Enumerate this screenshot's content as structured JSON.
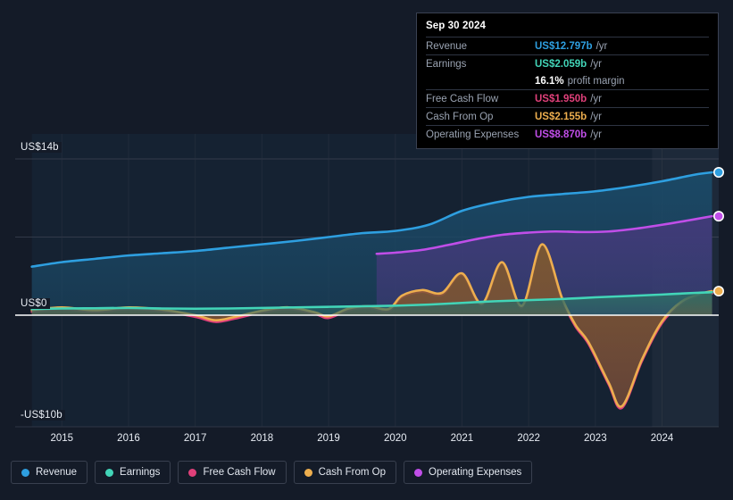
{
  "chart_data": {
    "type": "area",
    "title": "",
    "xlabel": "",
    "ylabel": "",
    "ylim": [
      -10,
      14
    ],
    "xlim": [
      2014.3,
      2024.85
    ],
    "grid": true,
    "legend_position": "bottom-left",
    "y_ticks": [
      {
        "value": 14,
        "label": "US$14b"
      },
      {
        "value": 0,
        "label": "US$0"
      },
      {
        "value": -10,
        "label": "-US$10b"
      }
    ],
    "x_ticks": [
      "2015",
      "2016",
      "2017",
      "2018",
      "2019",
      "2020",
      "2021",
      "2022",
      "2023",
      "2024"
    ],
    "x_tick_values": [
      2015,
      2016,
      2017,
      2018,
      2019,
      2020,
      2021,
      2022,
      2023,
      2024
    ],
    "series": [
      {
        "name": "Revenue",
        "color": "#2e9fe0",
        "fill": "#1b4a68",
        "x": [
          2014.55,
          2015.0,
          2015.5,
          2016.0,
          2016.5,
          2017.0,
          2017.5,
          2018.0,
          2018.5,
          2019.0,
          2019.5,
          2020.0,
          2020.5,
          2021.0,
          2021.5,
          2022.0,
          2022.5,
          2023.0,
          2023.5,
          2024.0,
          2024.5,
          2024.75
        ],
        "values": [
          4.35,
          4.75,
          5.05,
          5.35,
          5.55,
          5.75,
          6.05,
          6.35,
          6.65,
          7.0,
          7.35,
          7.55,
          8.1,
          9.35,
          10.1,
          10.6,
          10.85,
          11.1,
          11.5,
          12.0,
          12.6,
          12.797
        ]
      },
      {
        "name": "Earnings",
        "color": "#42d5b8",
        "fill": "#2e6b66",
        "x": [
          2014.55,
          2015.0,
          2015.5,
          2016.0,
          2016.5,
          2017.0,
          2017.5,
          2018.0,
          2018.5,
          2019.0,
          2019.5,
          2020.0,
          2020.5,
          2021.0,
          2021.5,
          2022.0,
          2022.5,
          2023.0,
          2023.5,
          2024.0,
          2024.5,
          2024.75
        ],
        "values": [
          0.55,
          0.6,
          0.62,
          0.65,
          0.6,
          0.58,
          0.6,
          0.65,
          0.7,
          0.75,
          0.8,
          0.85,
          0.95,
          1.1,
          1.25,
          1.35,
          1.45,
          1.6,
          1.72,
          1.85,
          2.0,
          2.059
        ]
      },
      {
        "name": "Free Cash Flow",
        "color": "#e0407a",
        "fill": "#6a2a45",
        "x": [
          2014.55,
          2015.0,
          2015.5,
          2016.0,
          2016.5,
          2017.0,
          2017.3,
          2017.6,
          2018.0,
          2018.4,
          2018.8,
          2019.0,
          2019.3,
          2019.6,
          2019.9,
          2020.1,
          2020.4,
          2020.7,
          2021.0,
          2021.3,
          2021.6,
          2021.9,
          2022.2,
          2022.5,
          2022.7,
          2022.9,
          2023.2,
          2023.4,
          2023.7,
          2024.0,
          2024.3,
          2024.6,
          2024.75
        ],
        "values": [
          0.3,
          0.55,
          0.3,
          0.55,
          0.35,
          -0.15,
          -0.6,
          -0.3,
          0.25,
          0.55,
          0.1,
          -0.25,
          0.45,
          0.65,
          0.4,
          1.6,
          2.1,
          1.85,
          3.6,
          0.9,
          4.6,
          0.7,
          6.2,
          1.4,
          -1.0,
          -2.6,
          -6.2,
          -8.3,
          -4.1,
          -0.7,
          1.1,
          1.8,
          1.95
        ]
      },
      {
        "name": "Cash From Op",
        "color": "#edae4e",
        "fill": "#7a5a33",
        "x": [
          2014.55,
          2015.0,
          2015.5,
          2016.0,
          2016.5,
          2017.0,
          2017.3,
          2017.6,
          2018.0,
          2018.4,
          2018.8,
          2019.0,
          2019.3,
          2019.6,
          2019.9,
          2020.1,
          2020.4,
          2020.7,
          2021.0,
          2021.3,
          2021.6,
          2021.9,
          2022.2,
          2022.5,
          2022.7,
          2022.9,
          2023.2,
          2023.4,
          2023.7,
          2024.0,
          2024.3,
          2024.6,
          2024.75
        ],
        "values": [
          0.45,
          0.7,
          0.45,
          0.7,
          0.5,
          0.0,
          -0.45,
          -0.15,
          0.4,
          0.7,
          0.25,
          -0.1,
          0.6,
          0.8,
          0.55,
          1.75,
          2.25,
          2.0,
          3.75,
          1.05,
          4.75,
          0.85,
          6.35,
          1.55,
          -0.85,
          -2.45,
          -6.05,
          -8.15,
          -3.95,
          -0.55,
          1.25,
          1.95,
          2.155
        ]
      },
      {
        "name": "Operating Expenses",
        "color": "#c04ee8",
        "fill": "#433a7a",
        "x": [
          2019.72,
          2020.0,
          2020.4,
          2020.8,
          2021.2,
          2021.6,
          2022.0,
          2022.4,
          2022.8,
          2023.2,
          2023.6,
          2024.0,
          2024.4,
          2024.75
        ],
        "values": [
          5.5,
          5.6,
          5.85,
          6.3,
          6.8,
          7.2,
          7.4,
          7.5,
          7.45,
          7.5,
          7.75,
          8.1,
          8.5,
          8.87
        ]
      }
    ],
    "end_markers": [
      {
        "series": "Revenue",
        "value": 12.797,
        "color": "#2e9fe0"
      },
      {
        "series": "Operating Expenses",
        "value": 8.87,
        "color": "#c04ee8"
      },
      {
        "series": "Cash From Op",
        "value": 2.155,
        "color": "#edae4e"
      }
    ],
    "highlight_band": {
      "from": 2023.85,
      "to": 2024.85
    }
  },
  "tooltip": {
    "date": "Sep 30 2024",
    "rows": [
      {
        "label": "Revenue",
        "value": "US$12.797b",
        "suffix": "/yr",
        "color": "#2e9fe0"
      },
      {
        "label": "Earnings",
        "value": "US$2.059b",
        "suffix": "/yr",
        "color": "#42d5b8"
      },
      {
        "label": "",
        "value": "16.1%",
        "suffix": "profit margin",
        "color": "#ffffff",
        "is_margin": true
      },
      {
        "label": "Free Cash Flow",
        "value": "US$1.950b",
        "suffix": "/yr",
        "color": "#e0407a"
      },
      {
        "label": "Cash From Op",
        "value": "US$2.155b",
        "suffix": "/yr",
        "color": "#edae4e"
      },
      {
        "label": "Operating Expenses",
        "value": "US$8.870b",
        "suffix": "/yr",
        "color": "#c04ee8"
      }
    ]
  },
  "legend": {
    "items": [
      {
        "label": "Revenue",
        "color": "#2e9fe0"
      },
      {
        "label": "Earnings",
        "color": "#42d5b8"
      },
      {
        "label": "Free Cash Flow",
        "color": "#e0407a"
      },
      {
        "label": "Cash From Op",
        "color": "#edae4e"
      },
      {
        "label": "Operating Expenses",
        "color": "#c04ee8"
      }
    ]
  }
}
